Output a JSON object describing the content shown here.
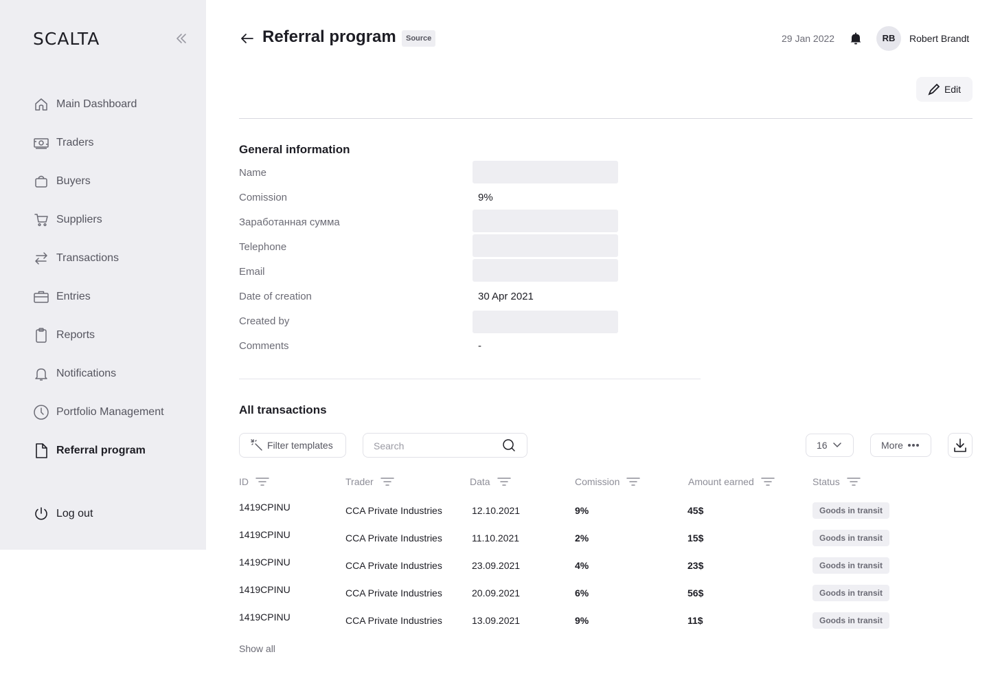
{
  "app": {
    "logo": "SCALTA"
  },
  "sidebar": {
    "items": [
      {
        "label": "Main Dashboard",
        "icon": "home-icon"
      },
      {
        "label": "Traders",
        "icon": "money-icon"
      },
      {
        "label": "Buyers",
        "icon": "bag-icon"
      },
      {
        "label": "Suppliers",
        "icon": "cart-icon"
      },
      {
        "label": "Transactions",
        "icon": "swap-icon"
      },
      {
        "label": "Entries",
        "icon": "briefcase-icon"
      },
      {
        "label": "Reports",
        "icon": "clipboard-icon"
      },
      {
        "label": "Notifications",
        "icon": "bell-icon"
      },
      {
        "label": "Portfolio Management",
        "icon": "clock-icon"
      },
      {
        "label": "Referral program",
        "icon": "document-icon",
        "active": true
      }
    ],
    "logout_label": "Log out"
  },
  "header": {
    "title": "Referral program",
    "badge": "Source",
    "date": "29 Jan 2022",
    "user_initials": "RB",
    "user_name": "Robert Brandt",
    "edit_label": "Edit"
  },
  "general": {
    "title": "General information",
    "fields": [
      {
        "label": "Name",
        "value": null
      },
      {
        "label": "Comission",
        "value": "9%"
      },
      {
        "label": "Заработанная сумма",
        "value": null
      },
      {
        "label": "Telephone",
        "value": null
      },
      {
        "label": "Email",
        "value": null
      },
      {
        "label": "Date of creation",
        "value": "30 Apr 2021"
      },
      {
        "label": "Created by",
        "value": null
      },
      {
        "label": "Comments",
        "value": "-"
      }
    ]
  },
  "transactions": {
    "title": "All transactions",
    "filter_label": "Filter templates",
    "search_placeholder": "Search",
    "page_size": "16",
    "more_label": "More",
    "columns": [
      "ID",
      "Trader",
      "Data",
      "Comission",
      "Amount earned",
      "Status"
    ],
    "rows": [
      {
        "id": "1419CPINU",
        "trader": "CCA Private Industries",
        "date": "12.10.2021",
        "commission": "9%",
        "amount": "45$",
        "status": "Goods in transit"
      },
      {
        "id": "1419CPINU",
        "trader": "CCA Private Industries",
        "date": "11.10.2021",
        "commission": "2%",
        "amount": "15$",
        "status": "Goods in transit"
      },
      {
        "id": "1419CPINU",
        "trader": "CCA Private Industries",
        "date": "23.09.2021",
        "commission": "4%",
        "amount": "23$",
        "status": "Goods in transit"
      },
      {
        "id": "1419CPINU",
        "trader": "CCA Private Industries",
        "date": "20.09.2021",
        "commission": "6%",
        "amount": "56$",
        "status": "Goods in transit"
      },
      {
        "id": "1419CPINU",
        "trader": "CCA Private Industries",
        "date": "13.09.2021",
        "commission": "9%",
        "amount": "11$",
        "status": "Goods in transit"
      }
    ],
    "show_all_label": "Show all"
  },
  "colors": {
    "sidebar_bg": "#eeeef2",
    "text_primary": "#1d1d24",
    "text_muted": "#6b6b75",
    "placeholder_bg": "#eeeef2"
  }
}
